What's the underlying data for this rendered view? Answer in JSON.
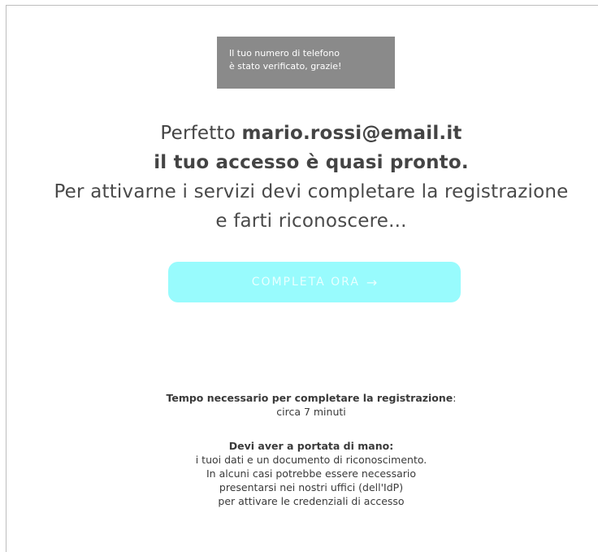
{
  "toast": {
    "line1": "Il tuo numero di telefono",
    "line2": "è stato verificato, grazie!"
  },
  "headline": {
    "prefix": "Perfetto ",
    "email": "mario.rossi@email.it",
    "line2": "il tuo accesso è quasi pronto.",
    "line3": "Per attivarne i servizi devi completare la registrazione",
    "line4": "e farti riconoscere..."
  },
  "cta": {
    "label": "COMPLETA ORA",
    "arrow": "→"
  },
  "time_info": {
    "title": "Tempo necessario per completare la registrazione",
    "colon": ":",
    "value": "circa 7 minuti"
  },
  "need_info": {
    "title": "Devi aver a portata di mano:",
    "line1": "i tuoi dati e un documento di riconoscimento.",
    "line2": "In alcuni casi potrebbe essere necessario",
    "line3": "presentarsi nei nostri uffici (dell'IdP)",
    "line4": "per attivare le credenziali di accesso"
  },
  "colors": {
    "toast_bg": "#8a8a8a",
    "cta_bg": "#98fbfd",
    "text": "#3a3a3a"
  },
  "icons": {
    "cta_arrow": "arrow-right-icon"
  }
}
